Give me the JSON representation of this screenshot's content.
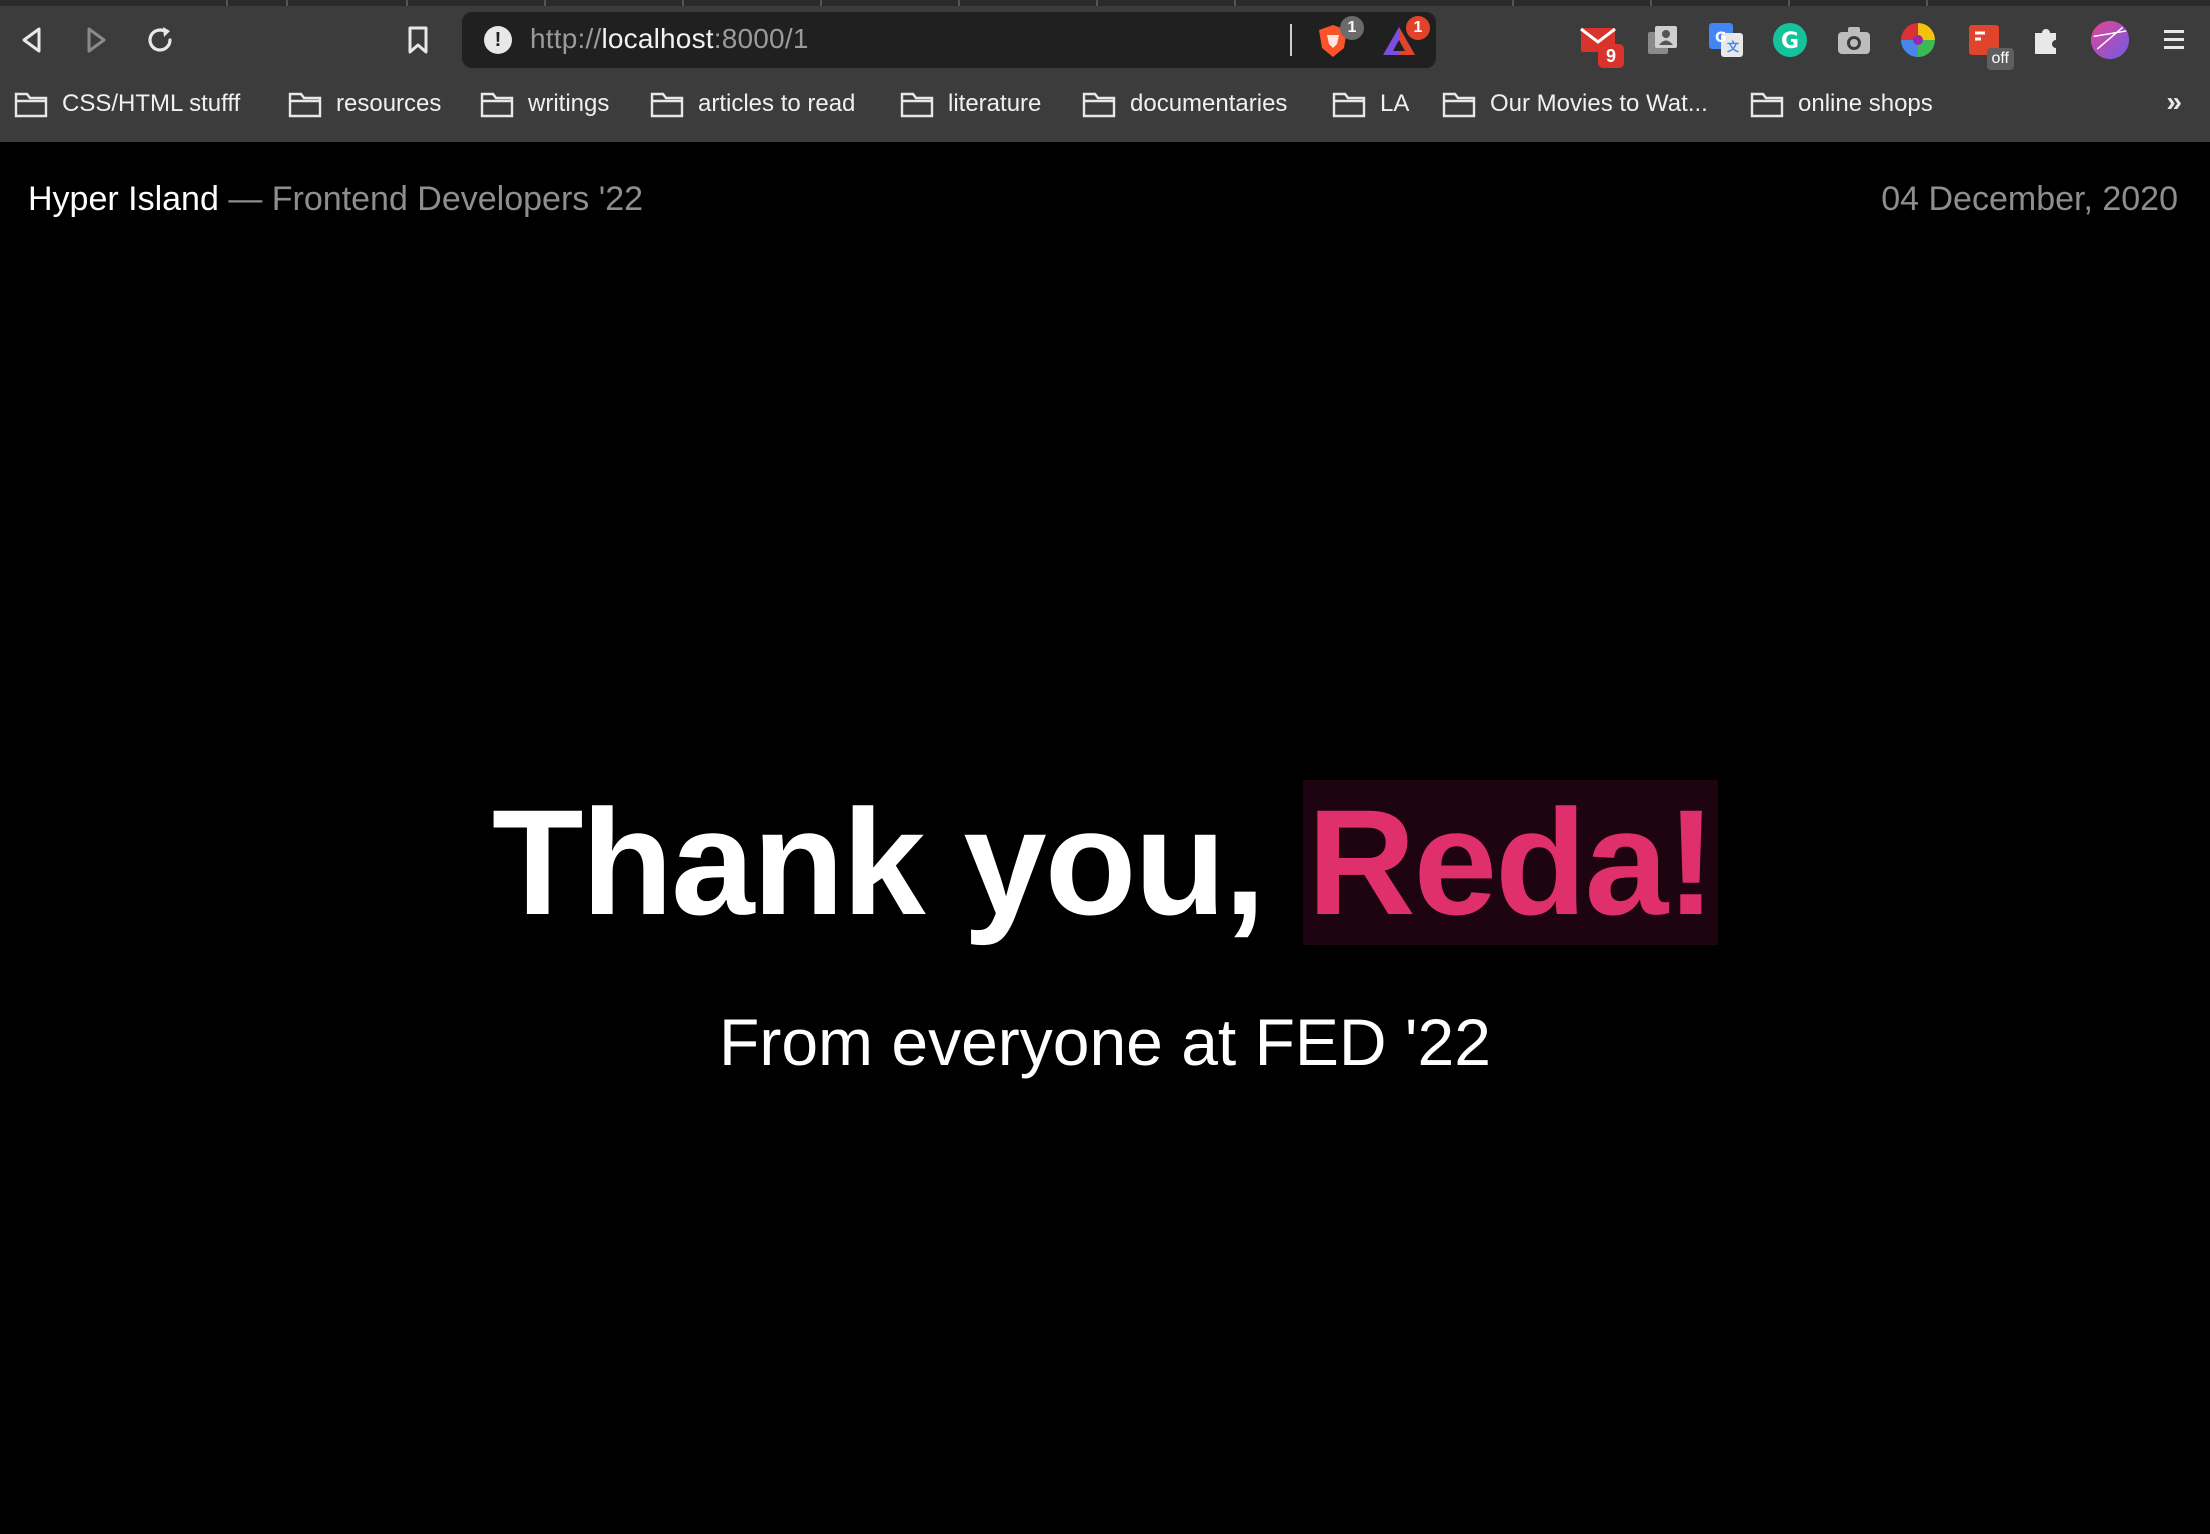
{
  "browser": {
    "url": {
      "scheme": "http://",
      "host": "localhost",
      "rest": ":8000/1"
    },
    "omnibox_icons": [
      {
        "name": "brave-shields-icon",
        "badge": "1",
        "badge_color": "#6b6b6b"
      },
      {
        "name": "brave-rewards-icon",
        "badge": "1",
        "badge_color": "#e0442b"
      }
    ],
    "extensions": [
      {
        "name": "gmail-icon",
        "badge": "9"
      },
      {
        "name": "contacts-icon"
      },
      {
        "name": "google-translate-icon"
      },
      {
        "name": "grammarly-icon"
      },
      {
        "name": "camera-icon"
      },
      {
        "name": "color-picker-icon"
      },
      {
        "name": "css-peeper-icon",
        "status": "off"
      },
      {
        "name": "puzzle-extensions-icon"
      },
      {
        "name": "profile-avatar-icon"
      },
      {
        "name": "menu-icon"
      }
    ],
    "bookmarks": [
      "CSS/HTML stufff",
      "resources",
      "writings",
      "articles to read",
      "literature",
      "documentaries",
      "LA",
      "Our Movies to Wat...",
      "online shops"
    ],
    "bookmarks_overflow": "»"
  },
  "page": {
    "brand_name": "Hyper Island",
    "brand_dash": "—",
    "brand_course": "Frontend Developers '22",
    "date": "04 December, 2020",
    "headline_prefix": "Thank you,",
    "headline_name": "Reda!",
    "subline": "From everyone at FED '22"
  },
  "colors": {
    "chrome_bg": "#3c3c3c",
    "page_bg": "#000000",
    "accent_pink": "#e0306b",
    "accent_bg": "#1e0410",
    "muted_text": "#8e8e8e"
  }
}
